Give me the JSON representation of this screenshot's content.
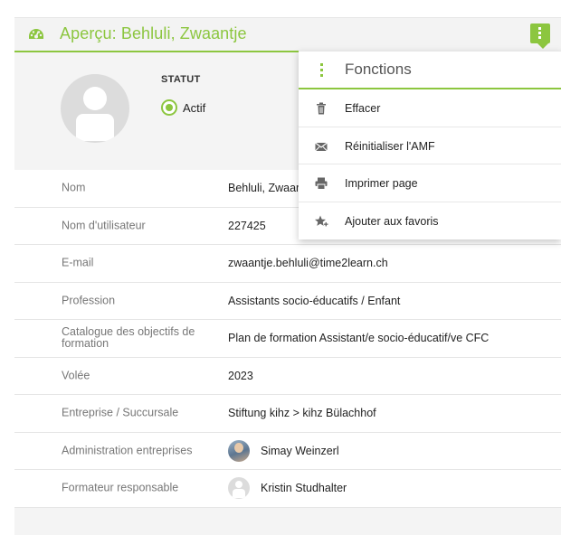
{
  "header": {
    "title": "Aperçu: Behluli, Zwaantje",
    "title_icon": "dashboard-gauge-icon",
    "menu_toggle_icon": "vertical-dots-icon",
    "accent_color": "#8cc63f"
  },
  "profile": {
    "avatar_icon": "default-user-avatar-icon",
    "status_label": "STATUT",
    "status_value": "Actif"
  },
  "details": [
    {
      "label": "Nom",
      "value": "Behluli, Zwaar"
    },
    {
      "label": "Nom d'utilisateur",
      "value": "227425"
    },
    {
      "label": "E-mail",
      "value": "zwaantje.behluli@time2learn.ch"
    },
    {
      "label": "Profession",
      "value": "Assistants socio-éducatifs / Enfant"
    },
    {
      "label": "Catalogue des objectifs de formation",
      "value": "Plan de formation Assistant/e socio-éducatif/ve CFC"
    },
    {
      "label": "Volée",
      "value": "2023"
    },
    {
      "label": "Entreprise / Succursale",
      "value": "Stiftung kihz > kihz Bülachhof"
    },
    {
      "label": "Administration entreprises",
      "value": "Simay Weinzerl",
      "avatar": "photo"
    },
    {
      "label": "Formateur responsable",
      "value": "Kristin Studhalter",
      "avatar": "default"
    }
  ],
  "dropdown": {
    "title": "Fonctions",
    "items": [
      {
        "label": "Effacer",
        "icon": "trash-icon"
      },
      {
        "label": "Réinitialiser l'AMF",
        "icon": "envelope-icon"
      },
      {
        "label": "Imprimer page",
        "icon": "printer-icon"
      },
      {
        "label": "Ajouter aux favoris",
        "icon": "star-add-icon"
      }
    ]
  }
}
